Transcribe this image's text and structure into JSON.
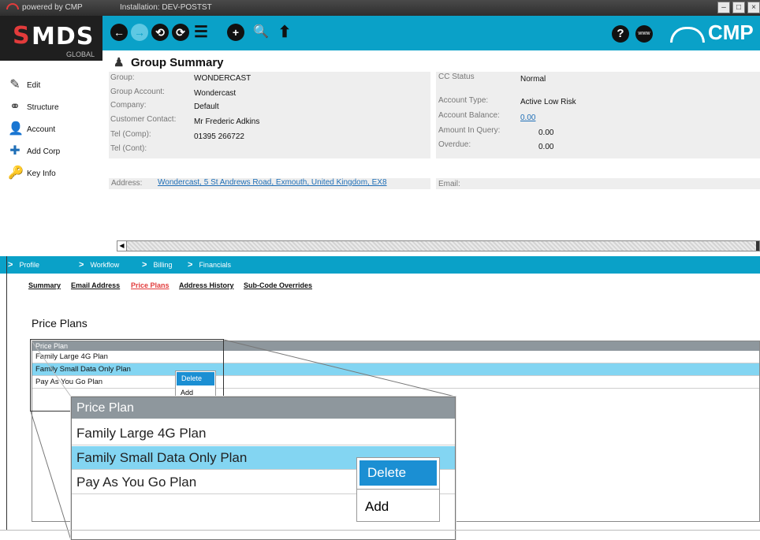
{
  "titlebar": {
    "powered": "powered by CMP",
    "installation": "Installation: DEV-POSTST",
    "min": "–",
    "max": "□",
    "close": "×"
  },
  "brand": {
    "s": "S",
    "mds": "MDS",
    "global": "GLOBAL",
    "cmp": "CMP"
  },
  "toolbar": {
    "back": "←",
    "forward": "→",
    "history": "⟲",
    "refresh": "⟳",
    "checklist": "☰",
    "add": "+",
    "search": "🔍",
    "upload": "⬆",
    "help": "?",
    "www": "www"
  },
  "leftnav": [
    {
      "label": "Edit",
      "icon": "✎"
    },
    {
      "label": "Structure",
      "icon": "⚭"
    },
    {
      "label": "Account",
      "icon": "👤"
    },
    {
      "label": "Add Corp",
      "icon": "✚"
    },
    {
      "label": "Key Info",
      "icon": "🔑"
    }
  ],
  "summary": {
    "title": "Group Summary",
    "group_label": "Group:",
    "group": "WONDERCAST",
    "group_account_label": "Group Account:",
    "group_account": "Wondercast",
    "company_label": "Company:",
    "company": "Default",
    "contact_label": "Customer Contact:",
    "contact": "Mr Frederic Adkins",
    "tel_comp_label": "Tel (Comp):",
    "tel_comp": "01395 266722",
    "tel_cont_label": "Tel (Cont):",
    "cc_status_label": "CC Status",
    "cc_status": "Normal",
    "account_type_label": "Account Type:",
    "account_type": "Active Low Risk",
    "account_balance_label": "Account Balance:",
    "account_balance": "0.00",
    "amount_query_label": "Amount In Query:",
    "amount_query": "0.00",
    "overdue_label": "Overdue:",
    "overdue": "0.00",
    "address_label": "Address:",
    "address": "Wondercast, 5 St Andrews Road, Exmouth, United Kingdom, EX8",
    "email_label": "Email:"
  },
  "sections": [
    "Profile",
    "Workflow",
    "Billing",
    "Financials"
  ],
  "subtabs": [
    "Summary",
    "Email Address",
    "Price Plans",
    "Address History",
    "Sub-Code Overrides"
  ],
  "price_plans": {
    "title": "Price Plans",
    "column": "Price Plan",
    "rows": [
      "Family Large 4G Plan",
      "Family Small Data Only Plan",
      "Pay As You Go Plan"
    ],
    "menu": [
      "Delete",
      "Add"
    ]
  },
  "colors": {
    "accent": "#0aa1c8",
    "selected_row": "#83d5f2",
    "menu_highlight": "#1b8fd3",
    "active_tab": "#e23b3b"
  }
}
